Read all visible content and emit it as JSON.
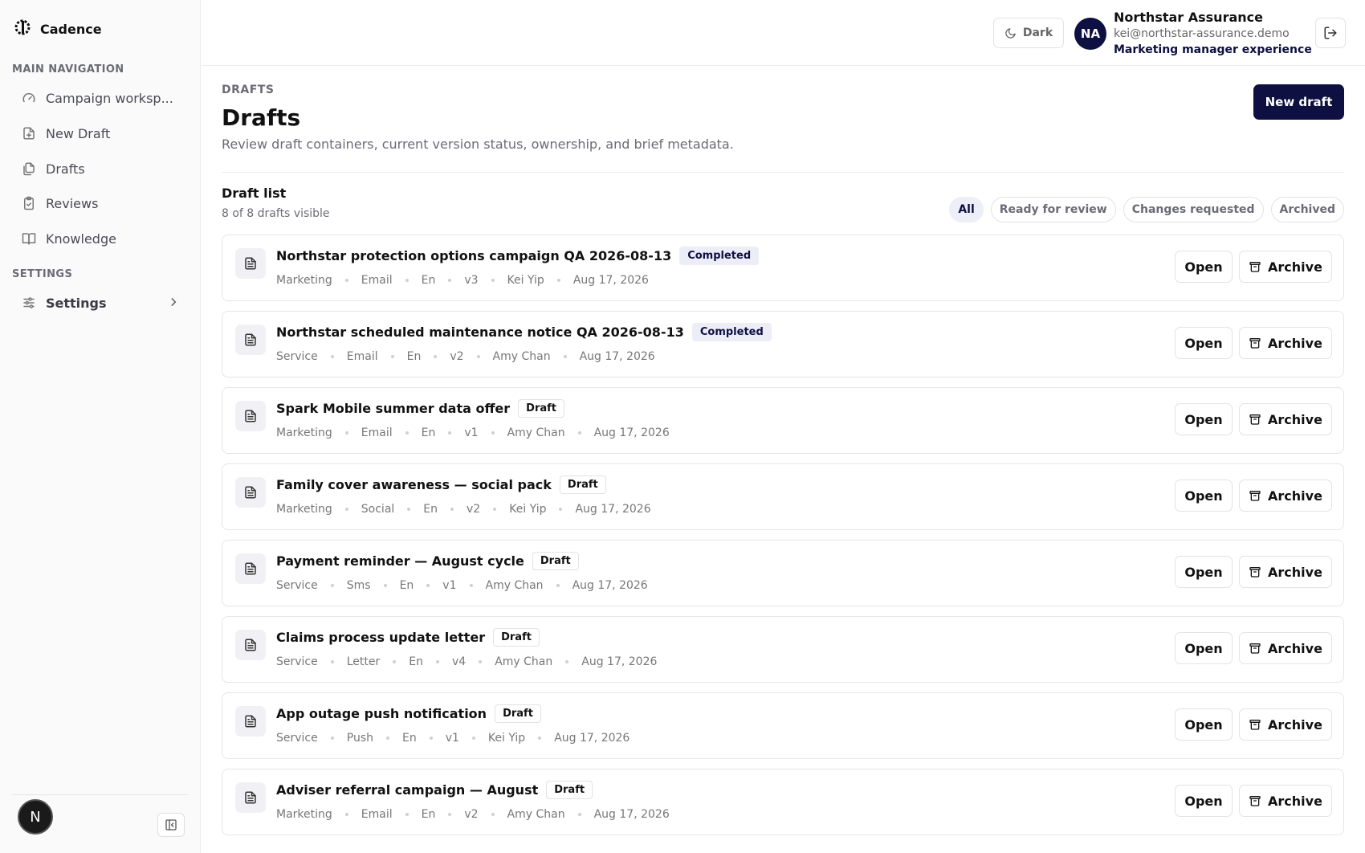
{
  "app": {
    "name": "Cadence"
  },
  "sidebar": {
    "main_section": "MAIN NAVIGATION",
    "items": [
      {
        "label": "Campaign worksp...",
        "icon": "gauge-icon"
      },
      {
        "label": "New Draft",
        "icon": "file-plus-icon"
      },
      {
        "label": "Drafts",
        "icon": "files-icon"
      },
      {
        "label": "Reviews",
        "icon": "clipboard-check-icon"
      },
      {
        "label": "Knowledge",
        "icon": "book-open-icon"
      }
    ],
    "settings_section": "SETTINGS",
    "settings_label": "Settings",
    "footer_badge": "N"
  },
  "header": {
    "theme_label": "Dark",
    "avatar_initials": "NA",
    "org_name": "Northstar Assurance",
    "email": "kei@northstar-assurance.demo",
    "role": "Marketing manager experience"
  },
  "page": {
    "eyebrow": "DRAFTS",
    "title": "Drafts",
    "description": "Review draft containers, current version status, ownership, and brief metadata.",
    "new_draft_label": "New draft"
  },
  "list": {
    "title": "Draft list",
    "count": "8 of 8 drafts visible",
    "filters": [
      "All",
      "Ready for review",
      "Changes requested",
      "Archived"
    ],
    "active_filter": "All",
    "open_label": "Open",
    "archive_label": "Archive",
    "drafts": [
      {
        "title": "Northstar protection options campaign QA 2026-08-13",
        "status": "Completed",
        "team": "Marketing",
        "channel": "Email",
        "lang": "En",
        "version": "v3",
        "owner": "Kei Yip",
        "date": "Aug 17, 2026"
      },
      {
        "title": "Northstar scheduled maintenance notice QA 2026-08-13",
        "status": "Completed",
        "team": "Service",
        "channel": "Email",
        "lang": "En",
        "version": "v2",
        "owner": "Amy Chan",
        "date": "Aug 17, 2026"
      },
      {
        "title": "Spark Mobile summer data offer",
        "status": "Draft",
        "team": "Marketing",
        "channel": "Email",
        "lang": "En",
        "version": "v1",
        "owner": "Amy Chan",
        "date": "Aug 17, 2026"
      },
      {
        "title": "Family cover awareness — social pack",
        "status": "Draft",
        "team": "Marketing",
        "channel": "Social",
        "lang": "En",
        "version": "v2",
        "owner": "Kei Yip",
        "date": "Aug 17, 2026"
      },
      {
        "title": "Payment reminder — August cycle",
        "status": "Draft",
        "team": "Service",
        "channel": "Sms",
        "lang": "En",
        "version": "v1",
        "owner": "Amy Chan",
        "date": "Aug 17, 2026"
      },
      {
        "title": "Claims process update letter",
        "status": "Draft",
        "team": "Service",
        "channel": "Letter",
        "lang": "En",
        "version": "v4",
        "owner": "Amy Chan",
        "date": "Aug 17, 2026"
      },
      {
        "title": "App outage push notification",
        "status": "Draft",
        "team": "Service",
        "channel": "Push",
        "lang": "En",
        "version": "v1",
        "owner": "Kei Yip",
        "date": "Aug 17, 2026"
      },
      {
        "title": "Adviser referral campaign — August",
        "status": "Draft",
        "team": "Marketing",
        "channel": "Email",
        "lang": "En",
        "version": "v2",
        "owner": "Amy Chan",
        "date": "Aug 17, 2026"
      }
    ]
  },
  "colors": {
    "brand": "#0d1040",
    "muted": "#6b6b76",
    "border": "#e6e6ea"
  }
}
